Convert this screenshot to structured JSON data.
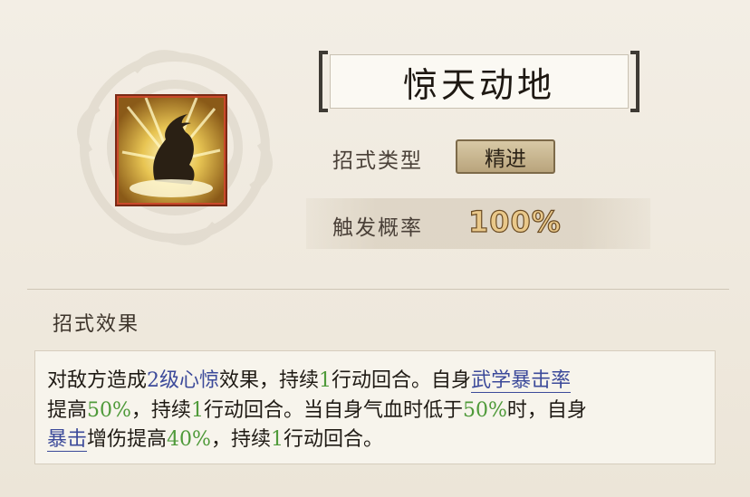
{
  "skill": {
    "name": "惊天动地",
    "icon": "erupting-burst-icon",
    "type_label": "招式类型",
    "type_value": "精进",
    "prob_label": "触发概率",
    "prob_value": "100%"
  },
  "effect": {
    "title": "招式效果",
    "lines": [
      [
        {
          "text": "对敌方造成",
          "style": "plain"
        },
        {
          "text": "2级",
          "style": "term"
        },
        {
          "text": "心惊",
          "style": "term"
        },
        {
          "text": "效果，持续",
          "style": "plain"
        },
        {
          "text": "1",
          "style": "num"
        },
        {
          "text": "行动回合。自身",
          "style": "plain"
        },
        {
          "text": "武学暴击率",
          "style": "link"
        }
      ],
      [
        {
          "text": "提高",
          "style": "plain"
        },
        {
          "text": "50%",
          "style": "num"
        },
        {
          "text": "，持续",
          "style": "plain"
        },
        {
          "text": "1",
          "style": "num"
        },
        {
          "text": "行动回合。当自身气血时低于",
          "style": "plain"
        },
        {
          "text": "50%",
          "style": "num"
        },
        {
          "text": "时，自身",
          "style": "plain"
        }
      ],
      [
        {
          "text": "暴击",
          "style": "link"
        },
        {
          "text": "增伤提高",
          "style": "plain"
        },
        {
          "text": "40%",
          "style": "num"
        },
        {
          "text": "，持续",
          "style": "plain"
        },
        {
          "text": "1",
          "style": "num"
        },
        {
          "text": "行动回合。",
          "style": "plain"
        }
      ]
    ]
  },
  "colors": {
    "accent_number": "#4f9a3a",
    "accent_link": "#3c4a9a",
    "icon_frame": "#c9492a"
  }
}
